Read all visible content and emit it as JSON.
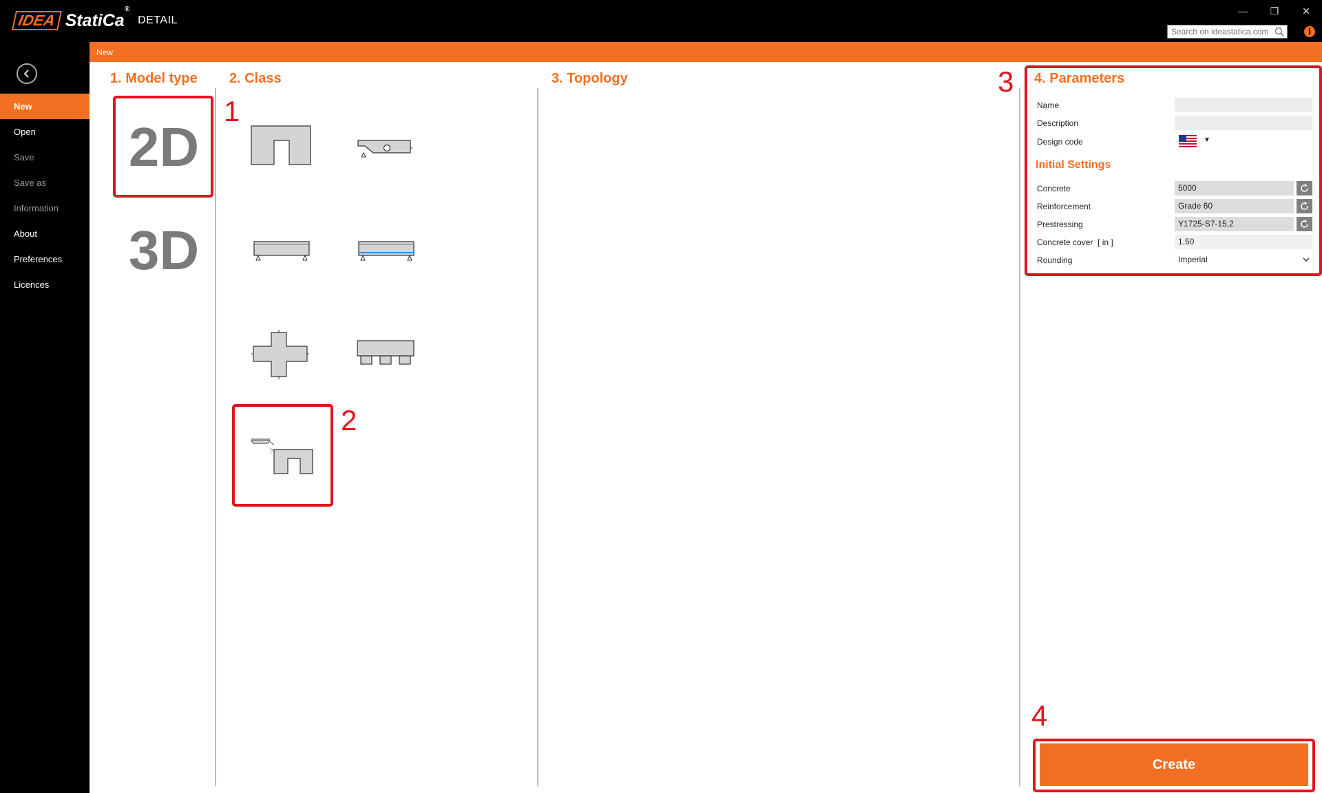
{
  "app": {
    "logo_brand": "IDEA",
    "logo_name": "StatiCa",
    "logo_mark": "®",
    "logo_product": "DETAIL"
  },
  "window": {
    "minimize_glyph": "—",
    "restore_glyph": "❐",
    "close_glyph": "✕"
  },
  "search": {
    "placeholder": "Search on ideastatica.com",
    "value": ""
  },
  "info_glyph": "i",
  "sidebar": {
    "items": [
      {
        "label": "New",
        "state": "active"
      },
      {
        "label": "Open",
        "state": "enabled"
      },
      {
        "label": "Save",
        "state": "disabled"
      },
      {
        "label": "Save as",
        "state": "disabled"
      },
      {
        "label": "Information",
        "state": "disabled"
      },
      {
        "label": "About",
        "state": "enabled"
      },
      {
        "label": "Preferences",
        "state": "enabled"
      },
      {
        "label": "Licences",
        "state": "enabled"
      }
    ]
  },
  "breadcrumb": "New",
  "sections": {
    "model_type": "1. Model type",
    "class": "2. Class",
    "topology": "3. Topology",
    "parameters": "4. Parameters"
  },
  "model_types": [
    "2D",
    "3D"
  ],
  "annotations": [
    "1",
    "2",
    "3",
    "4"
  ],
  "parameters": {
    "name_label": "Name",
    "name_value": "",
    "description_label": "Description",
    "description_value": "",
    "design_code_label": "Design code",
    "design_code_flag": "us-flag-icon",
    "design_code_caret": "▼",
    "initial_settings_title": "Initial Settings",
    "concrete_label": "Concrete",
    "concrete_value": "5000",
    "reinforcement_label": "Reinforcement",
    "reinforcement_value": "Grade 60",
    "prestressing_label": "Prestressing",
    "prestressing_value": "Y1725-S7-15,2",
    "cover_label": "Concrete cover",
    "cover_unit": "[ in ]",
    "cover_value": "1.50",
    "rounding_label": "Rounding",
    "rounding_value": "Imperial"
  },
  "create_label": "Create",
  "colors": {
    "accent": "#f36f21",
    "annotation": "#e0141c",
    "titlebar": "#000000"
  }
}
